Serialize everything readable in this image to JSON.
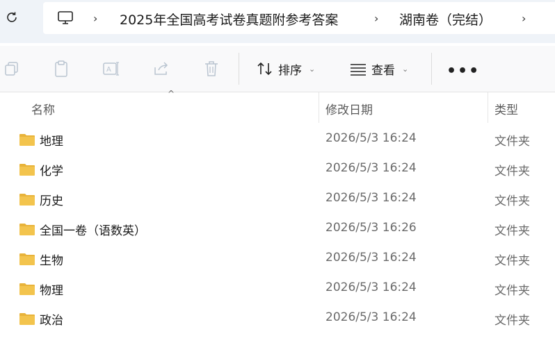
{
  "address": {
    "segments": [
      "2025年全国高考试卷真题附参考答案",
      "湖南卷（完结）"
    ]
  },
  "toolbar": {
    "sort_label": "排序",
    "view_label": "查看",
    "more_label": "•••"
  },
  "columns": {
    "name": "名称",
    "modified": "修改日期",
    "type": "类型"
  },
  "rows": [
    {
      "name": "地理",
      "modified": "2026/5/3 16:24",
      "type": "文件夹"
    },
    {
      "name": "化学",
      "modified": "2026/5/3 16:24",
      "type": "文件夹"
    },
    {
      "name": "历史",
      "modified": "2026/5/3 16:24",
      "type": "文件夹"
    },
    {
      "name": "全国一卷（语数英）",
      "modified": "2026/5/3 16:26",
      "type": "文件夹"
    },
    {
      "name": "生物",
      "modified": "2026/5/3 16:24",
      "type": "文件夹"
    },
    {
      "name": "物理",
      "modified": "2026/5/3 16:24",
      "type": "文件夹"
    },
    {
      "name": "政治",
      "modified": "2026/5/3 16:24",
      "type": "文件夹"
    }
  ],
  "colors": {
    "folder": "#f3c44d",
    "folder_tab": "#e8b33a",
    "toolbar_bg": "#f9f9fa",
    "address_bg": "#eff3f8"
  }
}
